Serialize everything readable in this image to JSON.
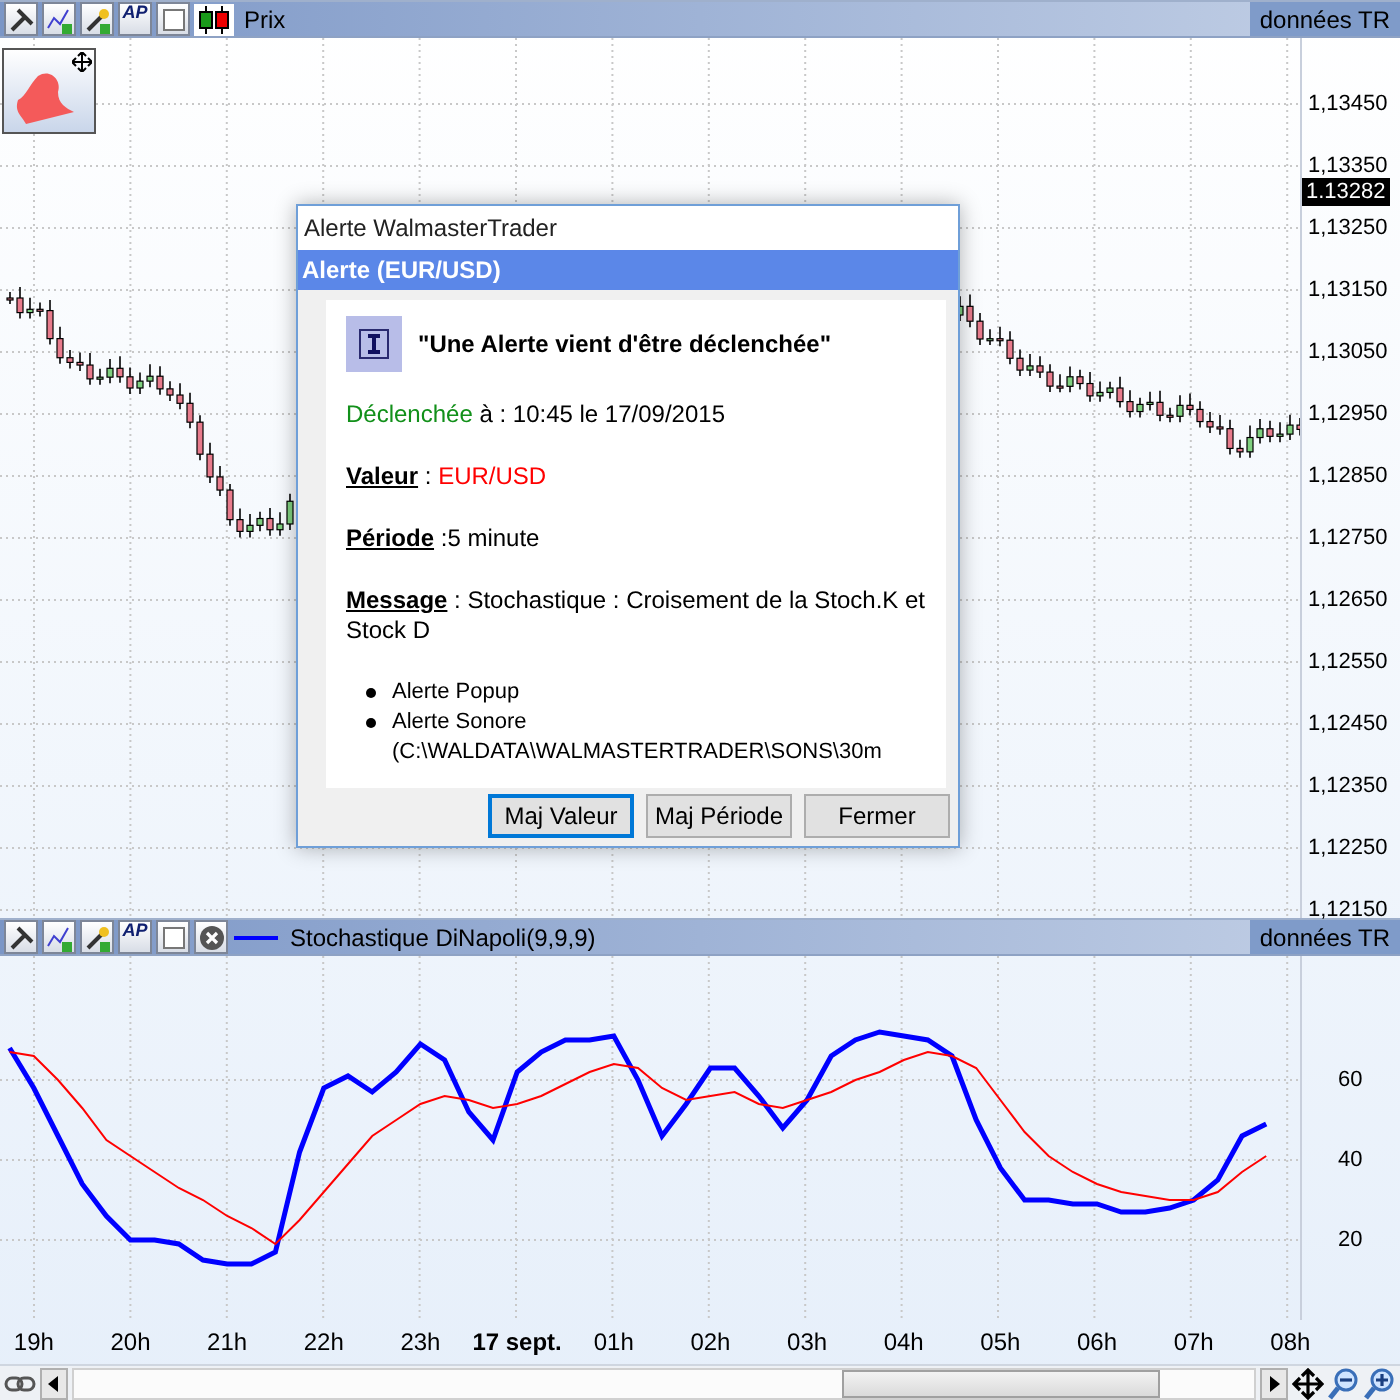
{
  "main_panel": {
    "ap_button": "AP",
    "title": "Prix",
    "data_source": "données TR",
    "price_axis": {
      "labels": [
        "1,13450",
        "1,13350",
        "1,13250",
        "1,13150",
        "1,13050",
        "1,12950",
        "1,12850",
        "1,12750",
        "1,12650",
        "1,12550",
        "1,12450",
        "1,12350",
        "1,12250",
        "1,12150"
      ],
      "last_price": "1.13282"
    }
  },
  "popup": {
    "title": "Alerte WalmasterTrader",
    "header": "Alerte (EUR/USD)",
    "heading": "\"Une Alerte vient d'être déclenchée\"",
    "lines": [
      {
        "kind": "status",
        "label": "Déclenchée",
        "text": "à : 10:45 le 17/09/2015"
      },
      {
        "kind": "field",
        "label": "Valeur",
        "text": ":",
        "value": "EUR/USD"
      },
      {
        "kind": "field",
        "label": "Période",
        "text": ":5 minute"
      },
      {
        "kind": "field",
        "label": "Message",
        "text": ": Stochastique : Croisement de la Stoch.K et Stock D"
      }
    ],
    "bullets": [
      "Alerte Popup",
      "Alerte Sonore (C:\\WALDATA\\WALMASTERTRADER\\SONS\\30m"
    ],
    "buttons": [
      {
        "label": "Maj Valeur",
        "focused": true
      },
      {
        "label": "Maj Période",
        "focused": false
      },
      {
        "label": "Fermer",
        "focused": false
      }
    ]
  },
  "lower_panel": {
    "ap_button": "AP",
    "data_source": "données TR",
    "chart_data": {
      "type": "line",
      "categories": [
        null,
        "19h",
        null,
        null,
        null,
        "20h",
        null,
        null,
        null,
        "21h",
        null,
        null,
        null,
        "22h",
        null,
        null,
        null,
        "23h",
        null,
        null,
        null,
        "**17 sept.**",
        null,
        null,
        null,
        "01h",
        null,
        null,
        null,
        "02h",
        null,
        null,
        null,
        "03h",
        null,
        null,
        null,
        "04h",
        null,
        null,
        null,
        "05h",
        null,
        null,
        null,
        "06h",
        null,
        null,
        null,
        "07h",
        null,
        null,
        null
      ],
      "series": [
        {
          "name": "Stochastique DiNapoli(9,9,9)",
          "color": "#0000ff",
          "values": [
            68,
            58,
            46,
            34,
            26,
            20,
            20,
            19,
            15,
            14,
            14,
            17,
            42,
            58,
            61,
            57,
            62,
            69,
            65,
            52,
            45,
            62,
            67,
            70,
            70,
            71,
            60,
            46,
            54,
            63,
            63,
            56,
            48,
            55,
            66,
            70,
            72,
            71,
            70,
            66,
            50,
            38,
            30,
            30,
            29,
            29,
            27,
            27,
            28,
            30,
            35,
            46,
            49
          ]
        },
        {
          "color": "#ff0000",
          "values": [
            67,
            66,
            60,
            53,
            45,
            41,
            37,
            33,
            30,
            26,
            23,
            19,
            25,
            32,
            39,
            46,
            50,
            54,
            56,
            55,
            53,
            54,
            56,
            59,
            62,
            64,
            63,
            58,
            55,
            56,
            57,
            54,
            53,
            55,
            57,
            60,
            62,
            65,
            67,
            66,
            63,
            55,
            47,
            41,
            37,
            34,
            32,
            31,
            30,
            30,
            32,
            37,
            41
          ]
        }
      ],
      "ylim": [
        0,
        91
      ],
      "yticks": [
        20,
        40,
        60
      ],
      "grid": true
    },
    "last_tick": "08h"
  }
}
